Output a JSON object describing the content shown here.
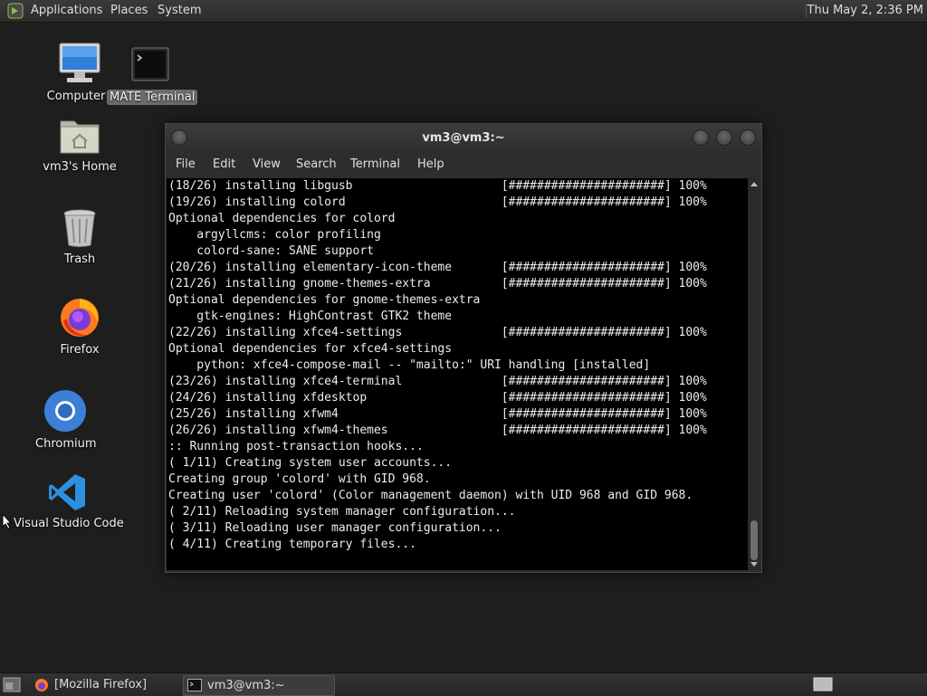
{
  "top_panel": {
    "menus": [
      "Applications",
      "Places",
      "System"
    ],
    "clock": "Thu May 2,  2:36 PM"
  },
  "desktop": {
    "icons": [
      "Computer",
      "MATE Terminal",
      "vm3's Home",
      "Trash",
      "Firefox",
      "Chromium",
      "Visual Studio Code"
    ]
  },
  "terminal": {
    "title": "vm3@vm3:~",
    "menus": [
      "File",
      "Edit",
      "View",
      "Search",
      "Terminal",
      "Help"
    ],
    "lines": [
      "(18/26) installing libgusb                     [######################] 100%",
      "(19/26) installing colord                      [######################] 100%",
      "Optional dependencies for colord",
      "    argyllcms: color profiling",
      "    colord-sane: SANE support",
      "(20/26) installing elementary-icon-theme       [######################] 100%",
      "(21/26) installing gnome-themes-extra          [######################] 100%",
      "Optional dependencies for gnome-themes-extra",
      "    gtk-engines: HighContrast GTK2 theme",
      "(22/26) installing xfce4-settings              [######################] 100%",
      "Optional dependencies for xfce4-settings",
      "    python: xfce4-compose-mail -- \"mailto:\" URI handling [installed]",
      "(23/26) installing xfce4-terminal              [######################] 100%",
      "(24/26) installing xfdesktop                   [######################] 100%",
      "(25/26) installing xfwm4                       [######################] 100%",
      "(26/26) installing xfwm4-themes                [######################] 100%",
      ":: Running post-transaction hooks...",
      "( 1/11) Creating system user accounts...",
      "Creating group 'colord' with GID 968.",
      "Creating user 'colord' (Color management daemon) with UID 968 and GID 968.",
      "( 2/11) Reloading system manager configuration...",
      "( 3/11) Reloading user manager configuration...",
      "( 4/11) Creating temporary files..."
    ]
  },
  "taskbar": {
    "tasks": [
      "[Mozilla Firefox]",
      "vm3@vm3:~"
    ]
  },
  "icons": {
    "menu_logo": "mate-menu-icon",
    "computer": "monitor-icon",
    "terminal": "terminal-icon",
    "home": "home-folder-icon",
    "trash": "trash-icon",
    "firefox": "firefox-icon",
    "chromium": "chromium-icon",
    "vscode": "vscode-icon"
  },
  "colors": {
    "desktop_bg": "#1e1e1e",
    "terminal_bg": "#000000",
    "vscode_blue": "#2d8fe0",
    "chromium_blue": "#3c7fd6"
  }
}
